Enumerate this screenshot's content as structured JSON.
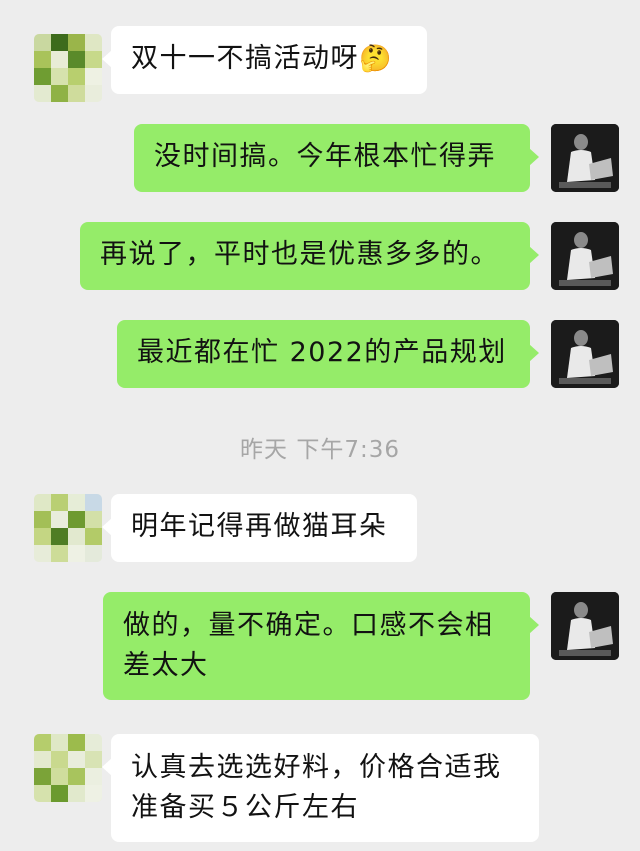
{
  "messages": [
    {
      "side": "left",
      "text": "双十一不搞活动呀",
      "emoji": "🤔"
    },
    {
      "side": "right",
      "text": "没时间搞。今年根本忙得弄"
    },
    {
      "side": "right",
      "text": "再说了，平时也是优惠多多的。"
    },
    {
      "side": "right",
      "text": "最近都在忙 2022的产品规划"
    },
    {
      "side": "left",
      "text": "明年记得再做猫耳朵"
    },
    {
      "side": "right",
      "text": "做的，量不确定。口感不会相差太大"
    },
    {
      "side": "left",
      "text": "认真去选选好料，价格合适我准备买５公斤左右"
    }
  ],
  "timestamp": "昨天 下午7:36",
  "colors": {
    "background": "#ededed",
    "incoming_bubble": "#ffffff",
    "outgoing_bubble": "#95ec69"
  },
  "icons": {
    "contact_avatar": "pixelated-avatar-icon",
    "self_avatar": "photo-avatar-icon"
  }
}
